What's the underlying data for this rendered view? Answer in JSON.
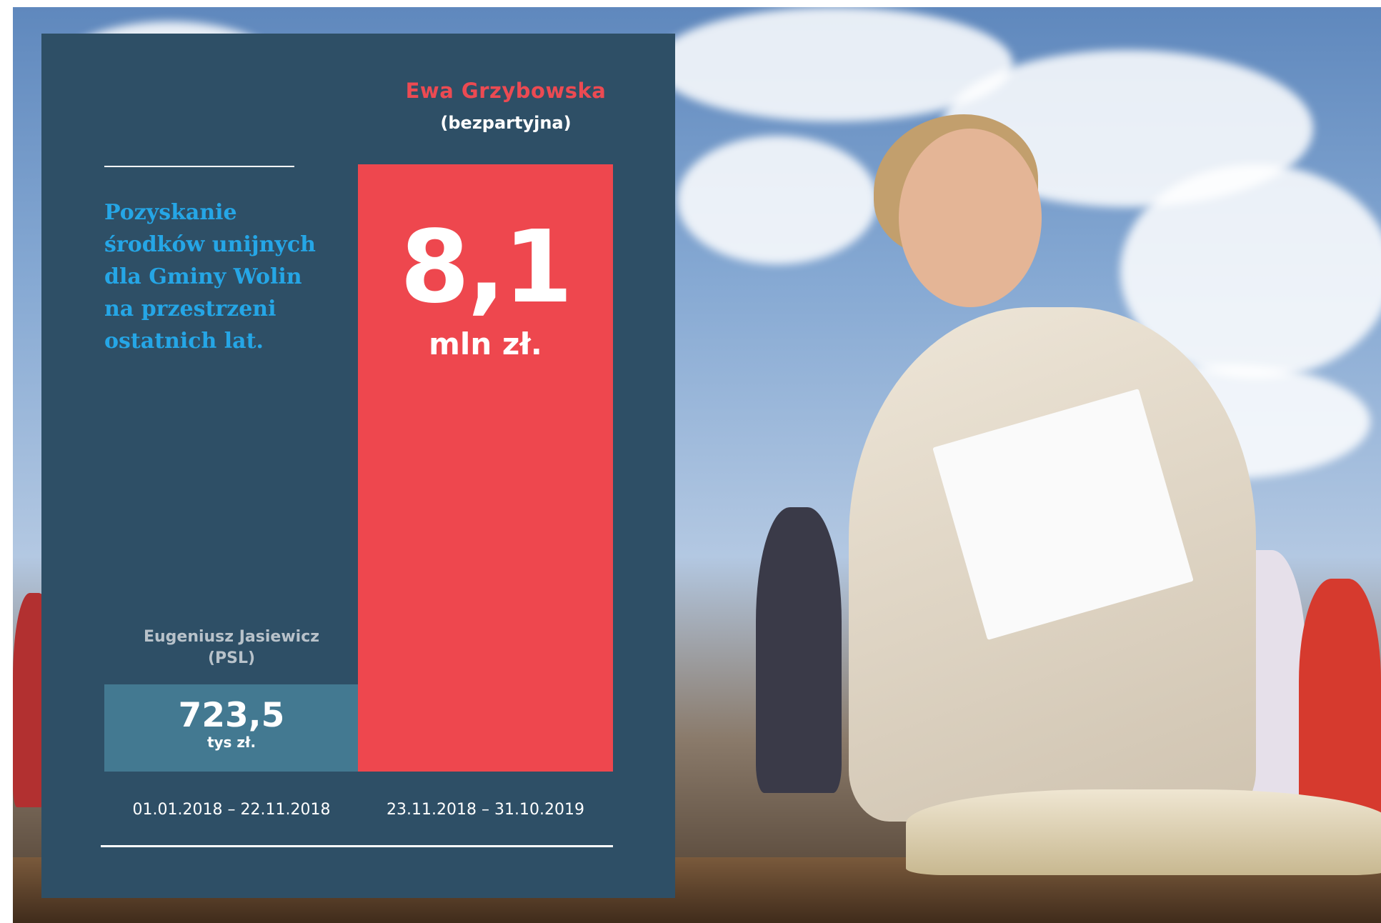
{
  "panel": {
    "description": "Pozyskanie środków unijnych dla Gminy Wolin na przestrzeni ostatnich lat.",
    "colors": {
      "panel": "#2e4f66",
      "accent_red": "#ee474e",
      "bar_blue": "#437991",
      "text_blue": "#25a6e6"
    }
  },
  "chart_data": {
    "type": "bar",
    "categories": [
      "01.01.2018  – 22.11.2018",
      "23.11.2018 – 31.10.2019"
    ],
    "series": [
      {
        "values": [
          0.7235,
          8.1
        ],
        "display_values": [
          "723,5",
          "8,1"
        ],
        "display_units": [
          "tys zł.",
          "mln zł."
        ],
        "colors": [
          "#437991",
          "#ee474e"
        ]
      }
    ],
    "bar_labels": [
      {
        "name": "Eugeniusz Jasiewicz",
        "party": "(PSL)"
      },
      {
        "name": "Ewa Grzybowska",
        "party": "(bezpartyjna)"
      }
    ],
    "unit_note": "values in mln zł",
    "ylim": [
      0,
      8.1
    ],
    "grid": false,
    "legend": "none"
  },
  "photo": {
    "subject": "woman-holding-document-icon"
  }
}
